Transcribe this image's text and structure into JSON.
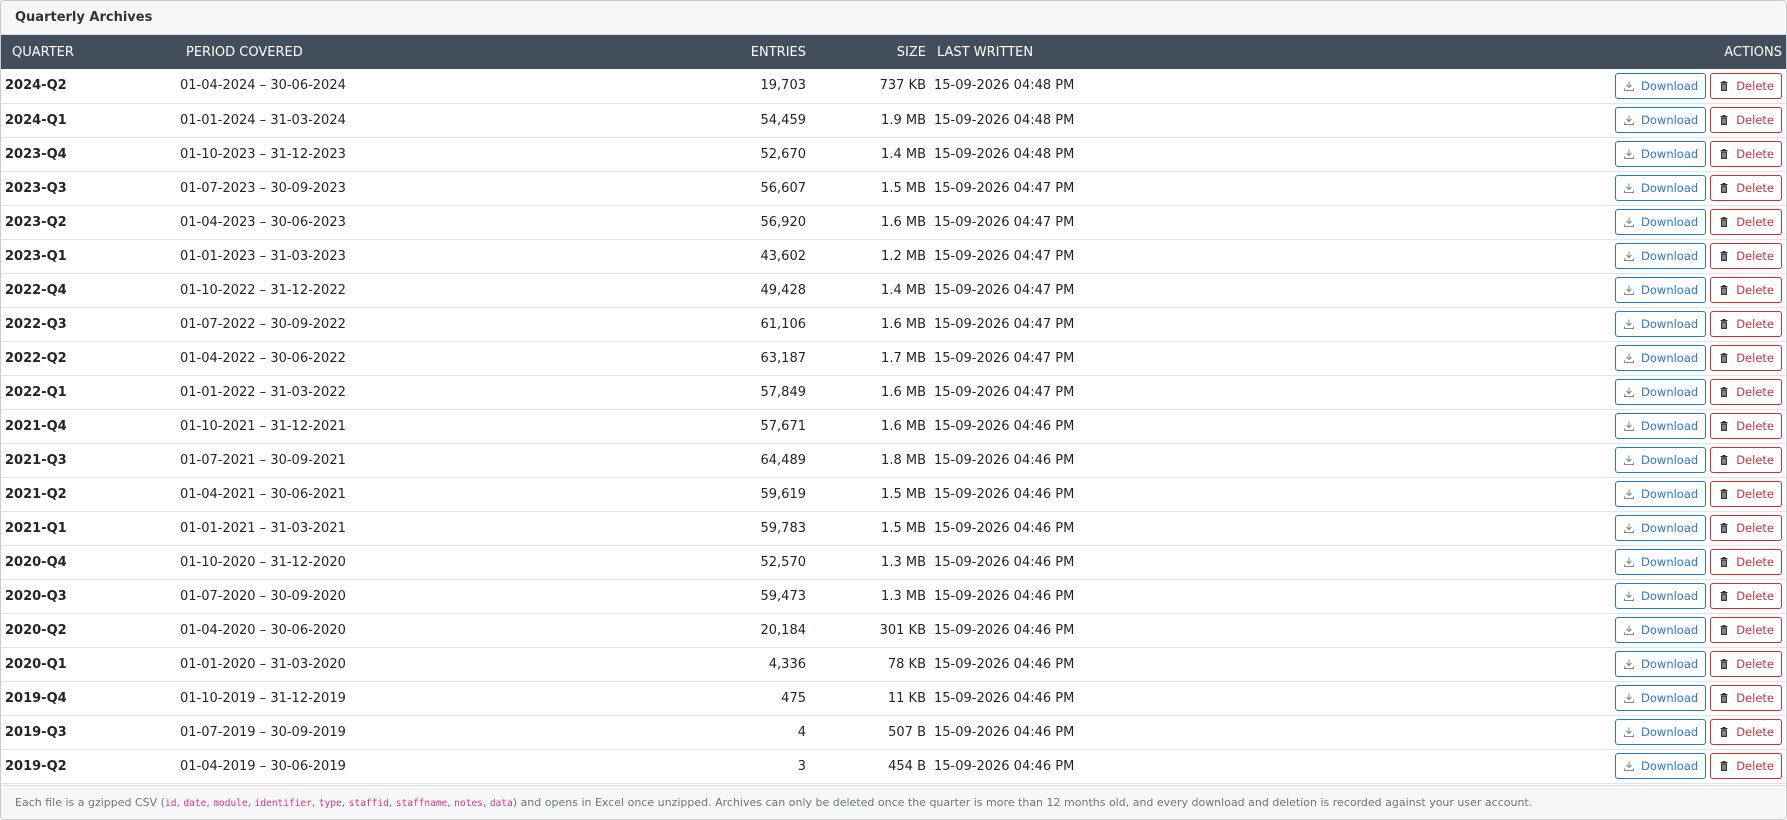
{
  "panel": {
    "title": "Quarterly Archives"
  },
  "columns": {
    "quarter": "QUARTER",
    "period": "PERIOD COVERED",
    "entries": "ENTRIES",
    "size": "SIZE",
    "last_written": "LAST WRITTEN",
    "actions": "ACTIONS"
  },
  "buttons": {
    "download": "Download",
    "delete": "Delete"
  },
  "rows": [
    {
      "quarter": "2024-Q2",
      "period": "01-04-2024 – 30-06-2024",
      "entries": "19,703",
      "size": "737 KB",
      "last_written": "15-09-2026 04:48 PM"
    },
    {
      "quarter": "2024-Q1",
      "period": "01-01-2024 – 31-03-2024",
      "entries": "54,459",
      "size": "1.9 MB",
      "last_written": "15-09-2026 04:48 PM"
    },
    {
      "quarter": "2023-Q4",
      "period": "01-10-2023 – 31-12-2023",
      "entries": "52,670",
      "size": "1.4 MB",
      "last_written": "15-09-2026 04:48 PM"
    },
    {
      "quarter": "2023-Q3",
      "period": "01-07-2023 – 30-09-2023",
      "entries": "56,607",
      "size": "1.5 MB",
      "last_written": "15-09-2026 04:47 PM"
    },
    {
      "quarter": "2023-Q2",
      "period": "01-04-2023 – 30-06-2023",
      "entries": "56,920",
      "size": "1.6 MB",
      "last_written": "15-09-2026 04:47 PM"
    },
    {
      "quarter": "2023-Q1",
      "period": "01-01-2023 – 31-03-2023",
      "entries": "43,602",
      "size": "1.2 MB",
      "last_written": "15-09-2026 04:47 PM"
    },
    {
      "quarter": "2022-Q4",
      "period": "01-10-2022 – 31-12-2022",
      "entries": "49,428",
      "size": "1.4 MB",
      "last_written": "15-09-2026 04:47 PM"
    },
    {
      "quarter": "2022-Q3",
      "period": "01-07-2022 – 30-09-2022",
      "entries": "61,106",
      "size": "1.6 MB",
      "last_written": "15-09-2026 04:47 PM"
    },
    {
      "quarter": "2022-Q2",
      "period": "01-04-2022 – 30-06-2022",
      "entries": "63,187",
      "size": "1.7 MB",
      "last_written": "15-09-2026 04:47 PM"
    },
    {
      "quarter": "2022-Q1",
      "period": "01-01-2022 – 31-03-2022",
      "entries": "57,849",
      "size": "1.6 MB",
      "last_written": "15-09-2026 04:47 PM"
    },
    {
      "quarter": "2021-Q4",
      "period": "01-10-2021 – 31-12-2021",
      "entries": "57,671",
      "size": "1.6 MB",
      "last_written": "15-09-2026 04:46 PM"
    },
    {
      "quarter": "2021-Q3",
      "period": "01-07-2021 – 30-09-2021",
      "entries": "64,489",
      "size": "1.8 MB",
      "last_written": "15-09-2026 04:46 PM"
    },
    {
      "quarter": "2021-Q2",
      "period": "01-04-2021 – 30-06-2021",
      "entries": "59,619",
      "size": "1.5 MB",
      "last_written": "15-09-2026 04:46 PM"
    },
    {
      "quarter": "2021-Q1",
      "period": "01-01-2021 – 31-03-2021",
      "entries": "59,783",
      "size": "1.5 MB",
      "last_written": "15-09-2026 04:46 PM"
    },
    {
      "quarter": "2020-Q4",
      "period": "01-10-2020 – 31-12-2020",
      "entries": "52,570",
      "size": "1.3 MB",
      "last_written": "15-09-2026 04:46 PM"
    },
    {
      "quarter": "2020-Q3",
      "period": "01-07-2020 – 30-09-2020",
      "entries": "59,473",
      "size": "1.3 MB",
      "last_written": "15-09-2026 04:46 PM"
    },
    {
      "quarter": "2020-Q2",
      "period": "01-04-2020 – 30-06-2020",
      "entries": "20,184",
      "size": "301 KB",
      "last_written": "15-09-2026 04:46 PM"
    },
    {
      "quarter": "2020-Q1",
      "period": "01-01-2020 – 31-03-2020",
      "entries": "4,336",
      "size": "78 KB",
      "last_written": "15-09-2026 04:46 PM"
    },
    {
      "quarter": "2019-Q4",
      "period": "01-10-2019 – 31-12-2019",
      "entries": "475",
      "size": "11 KB",
      "last_written": "15-09-2026 04:46 PM"
    },
    {
      "quarter": "2019-Q3",
      "period": "01-07-2019 – 30-09-2019",
      "entries": "4",
      "size": "507 B",
      "last_written": "15-09-2026 04:46 PM"
    },
    {
      "quarter": "2019-Q2",
      "period": "01-04-2019 – 30-06-2019",
      "entries": "3",
      "size": "454 B",
      "last_written": "15-09-2026 04:46 PM"
    }
  ],
  "footer": {
    "prefix": "Each file is a gzipped CSV (",
    "fields": [
      "id",
      "date",
      "module",
      "identifier",
      "type",
      "staffid",
      "staffname",
      "notes",
      "data"
    ],
    "separator": ", ",
    "suffix": ") and opens in Excel once unzipped. Archives can only be deleted once the quarter is more than 12 months old, and every download and deletion is recorded against your user account."
  },
  "icons": {
    "download": "download-icon",
    "delete": "trash-icon"
  },
  "colors": {
    "header_bg": "#424e5b",
    "download": "#2a78c8",
    "delete": "#c8313d",
    "code": "#d63384"
  }
}
